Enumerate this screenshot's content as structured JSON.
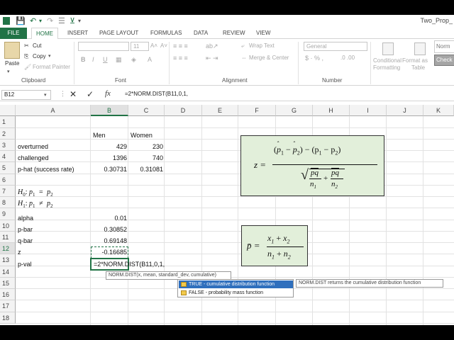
{
  "title_bar": {
    "doc_title": "Two_Prop_"
  },
  "ribbon": {
    "tabs": [
      "FILE",
      "HOME",
      "INSERT",
      "PAGE LAYOUT",
      "FORMULAS",
      "DATA",
      "REVIEW",
      "VIEW"
    ],
    "clipboard": {
      "paste": "Paste",
      "cut": "Cut",
      "copy": "Copy",
      "format_painter": "Format Painter",
      "label": "Clipboard"
    },
    "font": {
      "size": "11",
      "bold": "B",
      "italic": "I",
      "underline": "U",
      "label": "Font"
    },
    "alignment": {
      "wrap_text": "Wrap Text",
      "merge_center": "Merge & Center",
      "label": "Alignment"
    },
    "number": {
      "format": "General",
      "label": "Number"
    },
    "styles": {
      "conditional": "Conditional",
      "formatting": "Formatting",
      "format_as": "Format as",
      "table": "Table",
      "normal": "Norm",
      "check": "Check"
    }
  },
  "formula_bar": {
    "name_box": "B12",
    "cancel": "✕",
    "enter": "✓",
    "fx": "fx",
    "formula": "=2*NORM.DIST(B11,0,1,"
  },
  "grid": {
    "columns": [
      "A",
      "B",
      "C",
      "D",
      "E",
      "F",
      "G",
      "H",
      "I",
      "J",
      "K"
    ],
    "rows": [
      "1",
      "2",
      "3",
      "4",
      "5",
      "6",
      "7",
      "8",
      "9",
      "10",
      "11",
      "12",
      "13",
      "14",
      "15",
      "16",
      "17",
      "18"
    ],
    "cells": {
      "B1": "Men",
      "C1": "Women",
      "A2": "overturned",
      "B2": "429",
      "C2": "230",
      "A3": "challenged",
      "B3": "1396",
      "C3": "740",
      "A4": "p-hat (success rate)",
      "B4": "0.30731",
      "C4": "0.31081",
      "A6_h0": "H",
      "A6_sub": "0",
      "A6_rest": ": p",
      "A8": "alpha",
      "B8": "0.01",
      "A9": "p-bar",
      "B9": "0.30852",
      "A10": "q-bar",
      "B10": "0.69148",
      "A11": "z",
      "B11": "-0.16685",
      "A12": "p-val",
      "B12": "=2*NORM.DIST(B11,0,1,"
    },
    "hypotheses": {
      "h0": {
        "h": "H",
        "sub": "0",
        "colon": ":",
        "p1": "p",
        "s1": "1",
        "op": "=",
        "p2": "p",
        "s2": "2"
      },
      "h1": {
        "h": "H",
        "sub": "1",
        "colon": ":",
        "p1": "p",
        "s1": "1",
        "op": "≠",
        "p2": "p",
        "s2": "2"
      }
    }
  },
  "formula_z": {
    "lhs": "z =",
    "hat1": "p",
    "s1": "1",
    "hat2": "p",
    "s2": "2",
    "mid": "− (p",
    "ms1": "1",
    "minus": "− p",
    "ms2": "2",
    "close": ")",
    "den_pq": "pq",
    "n1": "n",
    "ns1": "1",
    "plus": "+",
    "n2": "n",
    "ns2": "2",
    "open": "(",
    "minus_hat": "−"
  },
  "formula_pbar": {
    "lhs": "p̄ =",
    "x1": "x",
    "xs1": "1",
    "plus": "+",
    "x2": "x",
    "xs2": "2",
    "n1": "n",
    "ns1": "1",
    "n2": "n",
    "ns2": "2"
  },
  "autocomplete": {
    "tooltip": "NORM.DIST(x, mean, standard_dev, cumulative)",
    "items": [
      "TRUE - cumulative distribution function",
      "FALSE - probability mass function"
    ],
    "description": "NORM.DIST returns the cumulative distribution function"
  }
}
